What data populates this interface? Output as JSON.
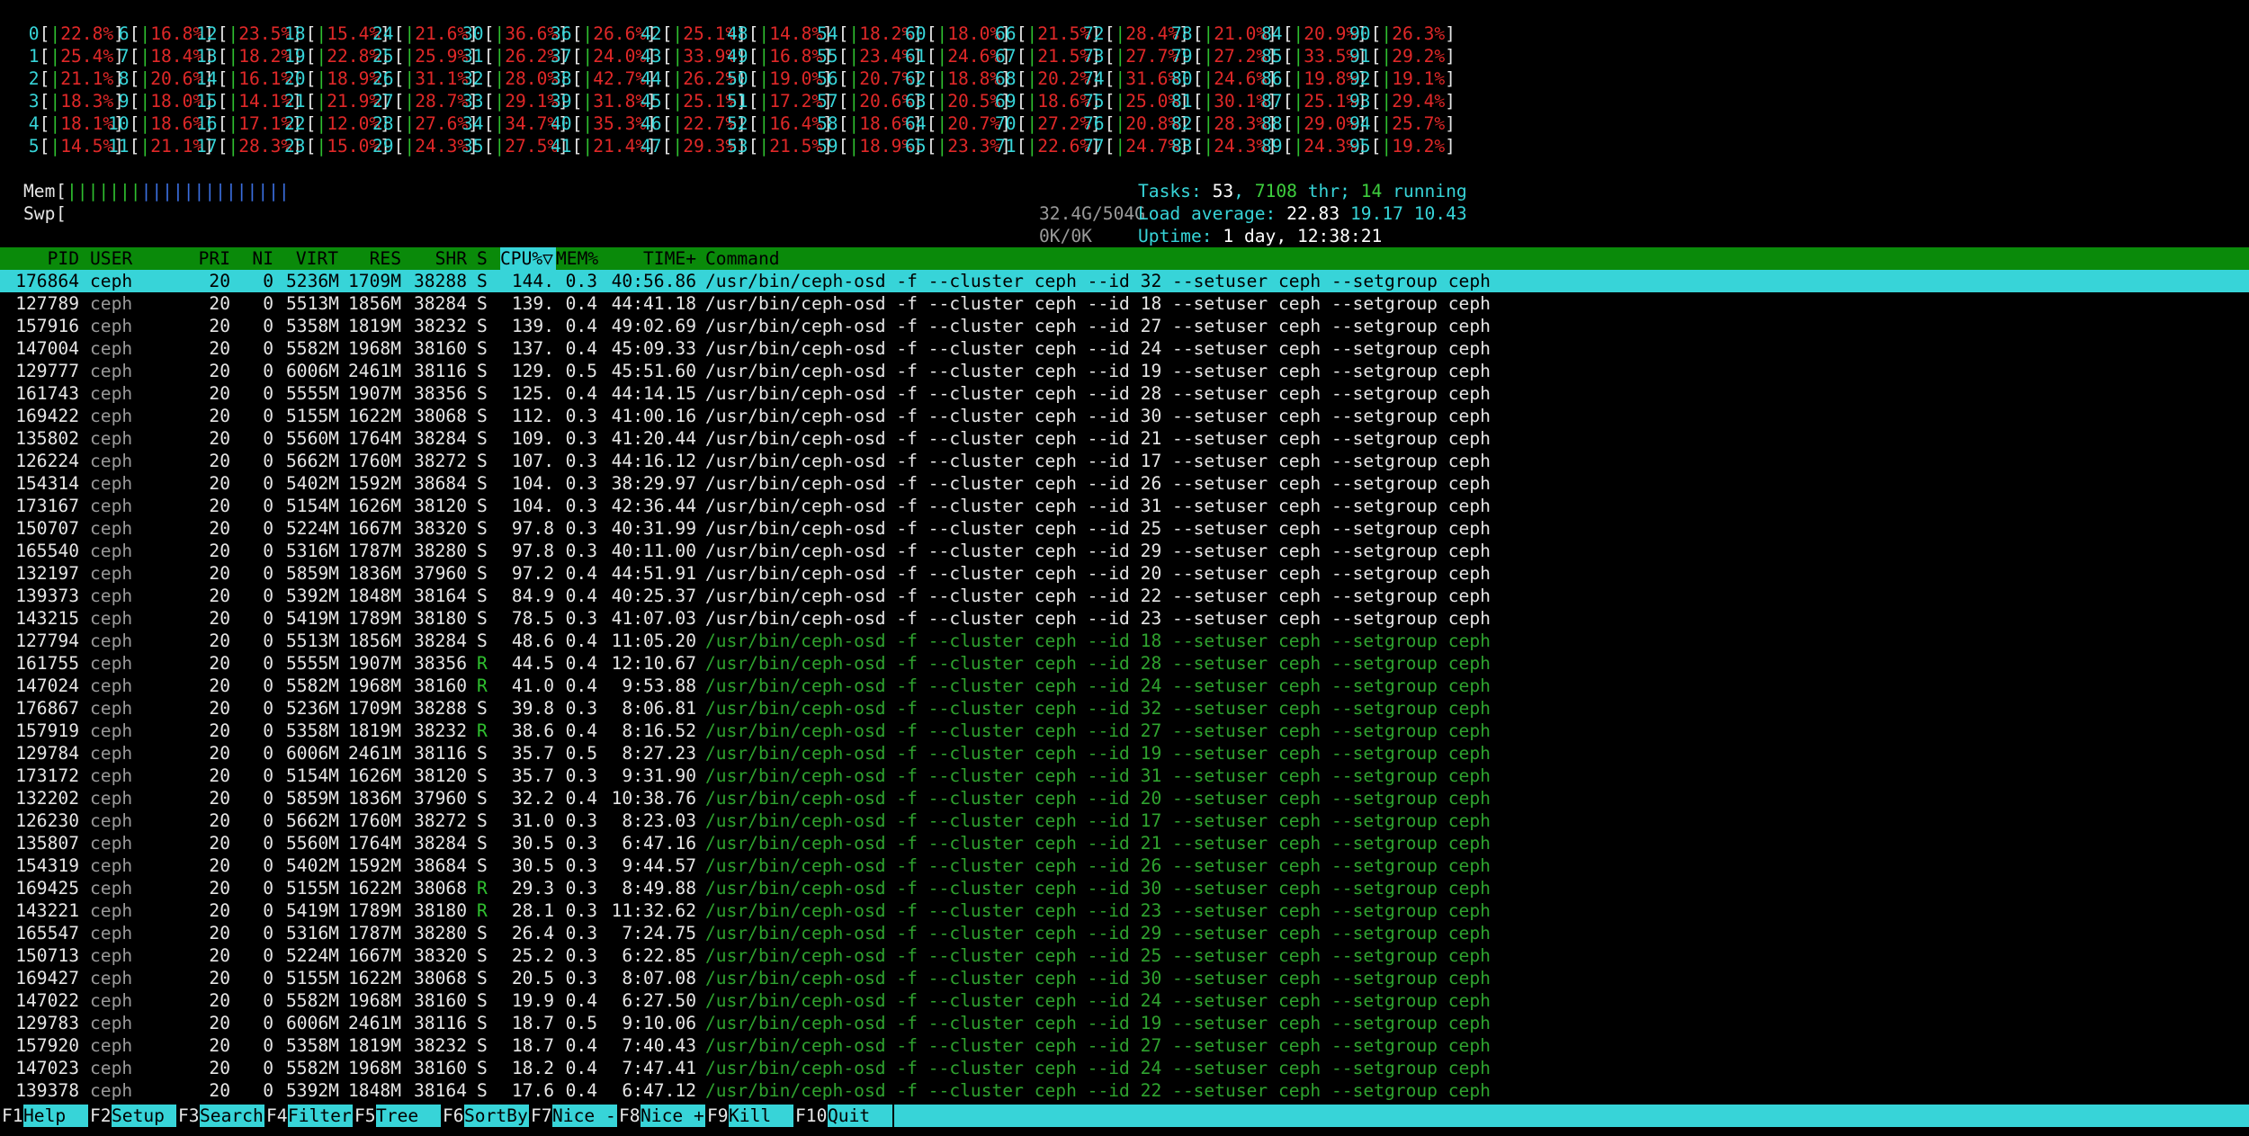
{
  "cpus": [
    {
      "id": "0",
      "pct": "22.8%"
    },
    {
      "id": "1",
      "pct": "25.4%"
    },
    {
      "id": "2",
      "pct": "21.1%"
    },
    {
      "id": "3",
      "pct": "18.3%"
    },
    {
      "id": "4",
      "pct": "18.1%"
    },
    {
      "id": "5",
      "pct": "14.5%"
    },
    {
      "id": "6",
      "pct": "16.8%"
    },
    {
      "id": "7",
      "pct": "18.4%"
    },
    {
      "id": "8",
      "pct": "20.6%"
    },
    {
      "id": "9",
      "pct": "18.0%"
    },
    {
      "id": "10",
      "pct": "18.6%"
    },
    {
      "id": "11",
      "pct": "21.1%"
    },
    {
      "id": "12",
      "pct": "23.5%"
    },
    {
      "id": "13",
      "pct": "18.2%"
    },
    {
      "id": "14",
      "pct": "16.1%"
    },
    {
      "id": "15",
      "pct": "14.1%"
    },
    {
      "id": "16",
      "pct": "17.1%"
    },
    {
      "id": "17",
      "pct": "28.3%"
    },
    {
      "id": "18",
      "pct": "15.4%"
    },
    {
      "id": "19",
      "pct": "22.8%"
    },
    {
      "id": "20",
      "pct": "18.9%"
    },
    {
      "id": "21",
      "pct": "21.9%"
    },
    {
      "id": "22",
      "pct": "12.0%"
    },
    {
      "id": "23",
      "pct": "15.0%"
    },
    {
      "id": "24",
      "pct": "21.6%"
    },
    {
      "id": "25",
      "pct": "25.9%"
    },
    {
      "id": "26",
      "pct": "31.1%"
    },
    {
      "id": "27",
      "pct": "28.7%"
    },
    {
      "id": "28",
      "pct": "27.6%"
    },
    {
      "id": "29",
      "pct": "24.3%"
    },
    {
      "id": "30",
      "pct": "36.6%"
    },
    {
      "id": "31",
      "pct": "26.2%"
    },
    {
      "id": "32",
      "pct": "28.0%"
    },
    {
      "id": "33",
      "pct": "29.1%"
    },
    {
      "id": "34",
      "pct": "34.7%"
    },
    {
      "id": "35",
      "pct": "27.5%"
    },
    {
      "id": "36",
      "pct": "26.6%"
    },
    {
      "id": "37",
      "pct": "24.0%"
    },
    {
      "id": "38",
      "pct": "42.7%"
    },
    {
      "id": "39",
      "pct": "31.8%"
    },
    {
      "id": "40",
      "pct": "35.3%"
    },
    {
      "id": "41",
      "pct": "21.4%"
    },
    {
      "id": "42",
      "pct": "25.1%"
    },
    {
      "id": "43",
      "pct": "33.9%"
    },
    {
      "id": "44",
      "pct": "26.2%"
    },
    {
      "id": "45",
      "pct": "25.1%"
    },
    {
      "id": "46",
      "pct": "22.7%"
    },
    {
      "id": "47",
      "pct": "29.3%"
    },
    {
      "id": "48",
      "pct": "14.8%"
    },
    {
      "id": "49",
      "pct": "16.8%"
    },
    {
      "id": "50",
      "pct": "19.0%"
    },
    {
      "id": "51",
      "pct": "17.2%"
    },
    {
      "id": "52",
      "pct": "16.4%"
    },
    {
      "id": "53",
      "pct": "21.5%"
    },
    {
      "id": "54",
      "pct": "18.2%"
    },
    {
      "id": "55",
      "pct": "23.4%"
    },
    {
      "id": "56",
      "pct": "20.7%"
    },
    {
      "id": "57",
      "pct": "20.6%"
    },
    {
      "id": "58",
      "pct": "18.6%"
    },
    {
      "id": "59",
      "pct": "18.9%"
    },
    {
      "id": "60",
      "pct": "18.0%"
    },
    {
      "id": "61",
      "pct": "24.6%"
    },
    {
      "id": "62",
      "pct": "18.8%"
    },
    {
      "id": "63",
      "pct": "20.5%"
    },
    {
      "id": "64",
      "pct": "20.7%"
    },
    {
      "id": "65",
      "pct": "23.3%"
    },
    {
      "id": "66",
      "pct": "21.5%"
    },
    {
      "id": "67",
      "pct": "21.5%"
    },
    {
      "id": "68",
      "pct": "20.2%"
    },
    {
      "id": "69",
      "pct": "18.6%"
    },
    {
      "id": "70",
      "pct": "27.2%"
    },
    {
      "id": "71",
      "pct": "22.6%"
    },
    {
      "id": "72",
      "pct": "28.4%"
    },
    {
      "id": "73",
      "pct": "27.7%"
    },
    {
      "id": "74",
      "pct": "31.6%"
    },
    {
      "id": "75",
      "pct": "25.0%"
    },
    {
      "id": "76",
      "pct": "20.8%"
    },
    {
      "id": "77",
      "pct": "24.7%"
    },
    {
      "id": "78",
      "pct": "21.0%"
    },
    {
      "id": "79",
      "pct": "27.2%"
    },
    {
      "id": "80",
      "pct": "24.6%"
    },
    {
      "id": "81",
      "pct": "30.1%"
    },
    {
      "id": "82",
      "pct": "28.3%"
    },
    {
      "id": "83",
      "pct": "24.3%"
    },
    {
      "id": "84",
      "pct": "20.9%"
    },
    {
      "id": "85",
      "pct": "33.5%"
    },
    {
      "id": "86",
      "pct": "19.8%"
    },
    {
      "id": "87",
      "pct": "25.1%"
    },
    {
      "id": "88",
      "pct": "29.0%"
    },
    {
      "id": "89",
      "pct": "24.3%"
    },
    {
      "id": "90",
      "pct": "26.3%"
    },
    {
      "id": "91",
      "pct": "29.2%"
    },
    {
      "id": "92",
      "pct": "19.1%"
    },
    {
      "id": "93",
      "pct": "29.4%"
    },
    {
      "id": "94",
      "pct": "25.7%"
    },
    {
      "id": "95",
      "pct": "19.2%"
    }
  ],
  "mem": {
    "label": "Mem",
    "bar": "||||||||||||||",
    "value": "32.4G/504G"
  },
  "swp": {
    "label": "Swp",
    "value": "0K/0K"
  },
  "tasks": {
    "label": "Tasks:",
    "count": "53",
    "sep1": ",",
    "thr": "7108",
    "thr_label": "thr;",
    "running": "14",
    "running_label": "running"
  },
  "load": {
    "label": "Load average:",
    "l1": "22.83",
    "l5": "19.17",
    "l15": "10.43"
  },
  "uptime": {
    "label": "Uptime:",
    "value": "1 day, 12:38:21"
  },
  "header": {
    "pid": "PID",
    "user": "USER",
    "pri": "PRI",
    "ni": "NI",
    "virt": "VIRT",
    "res": "RES",
    "shr": "SHR",
    "s": "S",
    "cpu": "CPU%▽",
    "mem": "MEM%",
    "time": "TIME+",
    "command": "Command"
  },
  "processes": [
    {
      "pid": "176864",
      "user": "ceph",
      "pri": "20",
      "ni": "0",
      "virt": "5236M",
      "res": "1709M",
      "shr": "38288",
      "s": "S",
      "cpu": "144.",
      "mem": "0.3",
      "time": "40:56.86",
      "command": "/usr/bin/ceph-osd -f --cluster ceph --id 32 --setuser ceph --setgroup ceph",
      "sel": true
    },
    {
      "pid": "127789",
      "user": "ceph",
      "pri": "20",
      "ni": "0",
      "virt": "5513M",
      "res": "1856M",
      "shr": "38284",
      "s": "S",
      "cpu": "139.",
      "mem": "0.4",
      "time": "44:41.18",
      "command": "/usr/bin/ceph-osd -f --cluster ceph --id 18 --setuser ceph --setgroup ceph"
    },
    {
      "pid": "157916",
      "user": "ceph",
      "pri": "20",
      "ni": "0",
      "virt": "5358M",
      "res": "1819M",
      "shr": "38232",
      "s": "S",
      "cpu": "139.",
      "mem": "0.4",
      "time": "49:02.69",
      "command": "/usr/bin/ceph-osd -f --cluster ceph --id 27 --setuser ceph --setgroup ceph"
    },
    {
      "pid": "147004",
      "user": "ceph",
      "pri": "20",
      "ni": "0",
      "virt": "5582M",
      "res": "1968M",
      "shr": "38160",
      "s": "S",
      "cpu": "137.",
      "mem": "0.4",
      "time": "45:09.33",
      "command": "/usr/bin/ceph-osd -f --cluster ceph --id 24 --setuser ceph --setgroup ceph"
    },
    {
      "pid": "129777",
      "user": "ceph",
      "pri": "20",
      "ni": "0",
      "virt": "6006M",
      "res": "2461M",
      "shr": "38116",
      "s": "S",
      "cpu": "129.",
      "mem": "0.5",
      "time": "45:51.60",
      "command": "/usr/bin/ceph-osd -f --cluster ceph --id 19 --setuser ceph --setgroup ceph"
    },
    {
      "pid": "161743",
      "user": "ceph",
      "pri": "20",
      "ni": "0",
      "virt": "5555M",
      "res": "1907M",
      "shr": "38356",
      "s": "S",
      "cpu": "125.",
      "mem": "0.4",
      "time": "44:14.15",
      "command": "/usr/bin/ceph-osd -f --cluster ceph --id 28 --setuser ceph --setgroup ceph"
    },
    {
      "pid": "169422",
      "user": "ceph",
      "pri": "20",
      "ni": "0",
      "virt": "5155M",
      "res": "1622M",
      "shr": "38068",
      "s": "S",
      "cpu": "112.",
      "mem": "0.3",
      "time": "41:00.16",
      "command": "/usr/bin/ceph-osd -f --cluster ceph --id 30 --setuser ceph --setgroup ceph"
    },
    {
      "pid": "135802",
      "user": "ceph",
      "pri": "20",
      "ni": "0",
      "virt": "5560M",
      "res": "1764M",
      "shr": "38284",
      "s": "S",
      "cpu": "109.",
      "mem": "0.3",
      "time": "41:20.44",
      "command": "/usr/bin/ceph-osd -f --cluster ceph --id 21 --setuser ceph --setgroup ceph"
    },
    {
      "pid": "126224",
      "user": "ceph",
      "pri": "20",
      "ni": "0",
      "virt": "5662M",
      "res": "1760M",
      "shr": "38272",
      "s": "S",
      "cpu": "107.",
      "mem": "0.3",
      "time": "44:16.12",
      "command": "/usr/bin/ceph-osd -f --cluster ceph --id 17 --setuser ceph --setgroup ceph"
    },
    {
      "pid": "154314",
      "user": "ceph",
      "pri": "20",
      "ni": "0",
      "virt": "5402M",
      "res": "1592M",
      "shr": "38684",
      "s": "S",
      "cpu": "104.",
      "mem": "0.3",
      "time": "38:29.97",
      "command": "/usr/bin/ceph-osd -f --cluster ceph --id 26 --setuser ceph --setgroup ceph"
    },
    {
      "pid": "173167",
      "user": "ceph",
      "pri": "20",
      "ni": "0",
      "virt": "5154M",
      "res": "1626M",
      "shr": "38120",
      "s": "S",
      "cpu": "104.",
      "mem": "0.3",
      "time": "42:36.44",
      "command": "/usr/bin/ceph-osd -f --cluster ceph --id 31 --setuser ceph --setgroup ceph"
    },
    {
      "pid": "150707",
      "user": "ceph",
      "pri": "20",
      "ni": "0",
      "virt": "5224M",
      "res": "1667M",
      "shr": "38320",
      "s": "S",
      "cpu": "97.8",
      "mem": "0.3",
      "time": "40:31.99",
      "command": "/usr/bin/ceph-osd -f --cluster ceph --id 25 --setuser ceph --setgroup ceph"
    },
    {
      "pid": "165540",
      "user": "ceph",
      "pri": "20",
      "ni": "0",
      "virt": "5316M",
      "res": "1787M",
      "shr": "38280",
      "s": "S",
      "cpu": "97.8",
      "mem": "0.3",
      "time": "40:11.00",
      "command": "/usr/bin/ceph-osd -f --cluster ceph --id 29 --setuser ceph --setgroup ceph"
    },
    {
      "pid": "132197",
      "user": "ceph",
      "pri": "20",
      "ni": "0",
      "virt": "5859M",
      "res": "1836M",
      "shr": "37960",
      "s": "S",
      "cpu": "97.2",
      "mem": "0.4",
      "time": "44:51.91",
      "command": "/usr/bin/ceph-osd -f --cluster ceph --id 20 --setuser ceph --setgroup ceph"
    },
    {
      "pid": "139373",
      "user": "ceph",
      "pri": "20",
      "ni": "0",
      "virt": "5392M",
      "res": "1848M",
      "shr": "38164",
      "s": "S",
      "cpu": "84.9",
      "mem": "0.4",
      "time": "40:25.37",
      "command": "/usr/bin/ceph-osd -f --cluster ceph --id 22 --setuser ceph --setgroup ceph"
    },
    {
      "pid": "143215",
      "user": "ceph",
      "pri": "20",
      "ni": "0",
      "virt": "5419M",
      "res": "1789M",
      "shr": "38180",
      "s": "S",
      "cpu": "78.5",
      "mem": "0.3",
      "time": "41:07.03",
      "command": "/usr/bin/ceph-osd -f --cluster ceph --id 23 --setuser ceph --setgroup ceph"
    },
    {
      "pid": "127794",
      "user": "ceph",
      "pri": "20",
      "ni": "0",
      "virt": "5513M",
      "res": "1856M",
      "shr": "38284",
      "s": "S",
      "cpu": "48.6",
      "mem": "0.4",
      "time": "11:05.20",
      "command": "/usr/bin/ceph-osd -f --cluster ceph --id 18 --setuser ceph --setgroup ceph",
      "thr": true
    },
    {
      "pid": "161755",
      "user": "ceph",
      "pri": "20",
      "ni": "0",
      "virt": "5555M",
      "res": "1907M",
      "shr": "38356",
      "s": "R",
      "cpu": "44.5",
      "mem": "0.4",
      "time": "12:10.67",
      "command": "/usr/bin/ceph-osd -f --cluster ceph --id 28 --setuser ceph --setgroup ceph",
      "thr": true
    },
    {
      "pid": "147024",
      "user": "ceph",
      "pri": "20",
      "ni": "0",
      "virt": "5582M",
      "res": "1968M",
      "shr": "38160",
      "s": "R",
      "cpu": "41.0",
      "mem": "0.4",
      "time": "9:53.88",
      "command": "/usr/bin/ceph-osd -f --cluster ceph --id 24 --setuser ceph --setgroup ceph",
      "thr": true
    },
    {
      "pid": "176867",
      "user": "ceph",
      "pri": "20",
      "ni": "0",
      "virt": "5236M",
      "res": "1709M",
      "shr": "38288",
      "s": "S",
      "cpu": "39.8",
      "mem": "0.3",
      "time": "8:06.81",
      "command": "/usr/bin/ceph-osd -f --cluster ceph --id 32 --setuser ceph --setgroup ceph",
      "thr": true
    },
    {
      "pid": "157919",
      "user": "ceph",
      "pri": "20",
      "ni": "0",
      "virt": "5358M",
      "res": "1819M",
      "shr": "38232",
      "s": "R",
      "cpu": "38.6",
      "mem": "0.4",
      "time": "8:16.52",
      "command": "/usr/bin/ceph-osd -f --cluster ceph --id 27 --setuser ceph --setgroup ceph",
      "thr": true
    },
    {
      "pid": "129784",
      "user": "ceph",
      "pri": "20",
      "ni": "0",
      "virt": "6006M",
      "res": "2461M",
      "shr": "38116",
      "s": "S",
      "cpu": "35.7",
      "mem": "0.5",
      "time": "8:27.23",
      "command": "/usr/bin/ceph-osd -f --cluster ceph --id 19 --setuser ceph --setgroup ceph",
      "thr": true
    },
    {
      "pid": "173172",
      "user": "ceph",
      "pri": "20",
      "ni": "0",
      "virt": "5154M",
      "res": "1626M",
      "shr": "38120",
      "s": "S",
      "cpu": "35.7",
      "mem": "0.3",
      "time": "9:31.90",
      "command": "/usr/bin/ceph-osd -f --cluster ceph --id 31 --setuser ceph --setgroup ceph",
      "thr": true
    },
    {
      "pid": "132202",
      "user": "ceph",
      "pri": "20",
      "ni": "0",
      "virt": "5859M",
      "res": "1836M",
      "shr": "37960",
      "s": "S",
      "cpu": "32.2",
      "mem": "0.4",
      "time": "10:38.76",
      "command": "/usr/bin/ceph-osd -f --cluster ceph --id 20 --setuser ceph --setgroup ceph",
      "thr": true
    },
    {
      "pid": "126230",
      "user": "ceph",
      "pri": "20",
      "ni": "0",
      "virt": "5662M",
      "res": "1760M",
      "shr": "38272",
      "s": "S",
      "cpu": "31.0",
      "mem": "0.3",
      "time": "8:23.03",
      "command": "/usr/bin/ceph-osd -f --cluster ceph --id 17 --setuser ceph --setgroup ceph",
      "thr": true
    },
    {
      "pid": "135807",
      "user": "ceph",
      "pri": "20",
      "ni": "0",
      "virt": "5560M",
      "res": "1764M",
      "shr": "38284",
      "s": "S",
      "cpu": "30.5",
      "mem": "0.3",
      "time": "6:47.16",
      "command": "/usr/bin/ceph-osd -f --cluster ceph --id 21 --setuser ceph --setgroup ceph",
      "thr": true
    },
    {
      "pid": "154319",
      "user": "ceph",
      "pri": "20",
      "ni": "0",
      "virt": "5402M",
      "res": "1592M",
      "shr": "38684",
      "s": "S",
      "cpu": "30.5",
      "mem": "0.3",
      "time": "9:44.57",
      "command": "/usr/bin/ceph-osd -f --cluster ceph --id 26 --setuser ceph --setgroup ceph",
      "thr": true
    },
    {
      "pid": "169425",
      "user": "ceph",
      "pri": "20",
      "ni": "0",
      "virt": "5155M",
      "res": "1622M",
      "shr": "38068",
      "s": "R",
      "cpu": "29.3",
      "mem": "0.3",
      "time": "8:49.88",
      "command": "/usr/bin/ceph-osd -f --cluster ceph --id 30 --setuser ceph --setgroup ceph",
      "thr": true
    },
    {
      "pid": "143221",
      "user": "ceph",
      "pri": "20",
      "ni": "0",
      "virt": "5419M",
      "res": "1789M",
      "shr": "38180",
      "s": "R",
      "cpu": "28.1",
      "mem": "0.3",
      "time": "11:32.62",
      "command": "/usr/bin/ceph-osd -f --cluster ceph --id 23 --setuser ceph --setgroup ceph",
      "thr": true
    },
    {
      "pid": "165547",
      "user": "ceph",
      "pri": "20",
      "ni": "0",
      "virt": "5316M",
      "res": "1787M",
      "shr": "38280",
      "s": "S",
      "cpu": "26.4",
      "mem": "0.3",
      "time": "7:24.75",
      "command": "/usr/bin/ceph-osd -f --cluster ceph --id 29 --setuser ceph --setgroup ceph",
      "thr": true
    },
    {
      "pid": "150713",
      "user": "ceph",
      "pri": "20",
      "ni": "0",
      "virt": "5224M",
      "res": "1667M",
      "shr": "38320",
      "s": "S",
      "cpu": "25.2",
      "mem": "0.3",
      "time": "6:22.85",
      "command": "/usr/bin/ceph-osd -f --cluster ceph --id 25 --setuser ceph --setgroup ceph",
      "thr": true
    },
    {
      "pid": "169427",
      "user": "ceph",
      "pri": "20",
      "ni": "0",
      "virt": "5155M",
      "res": "1622M",
      "shr": "38068",
      "s": "S",
      "cpu": "20.5",
      "mem": "0.3",
      "time": "8:07.08",
      "command": "/usr/bin/ceph-osd -f --cluster ceph --id 30 --setuser ceph --setgroup ceph",
      "thr": true
    },
    {
      "pid": "147022",
      "user": "ceph",
      "pri": "20",
      "ni": "0",
      "virt": "5582M",
      "res": "1968M",
      "shr": "38160",
      "s": "S",
      "cpu": "19.9",
      "mem": "0.4",
      "time": "6:27.50",
      "command": "/usr/bin/ceph-osd -f --cluster ceph --id 24 --setuser ceph --setgroup ceph",
      "thr": true
    },
    {
      "pid": "129783",
      "user": "ceph",
      "pri": "20",
      "ni": "0",
      "virt": "6006M",
      "res": "2461M",
      "shr": "38116",
      "s": "S",
      "cpu": "18.7",
      "mem": "0.5",
      "time": "9:10.06",
      "command": "/usr/bin/ceph-osd -f --cluster ceph --id 19 --setuser ceph --setgroup ceph",
      "thr": true
    },
    {
      "pid": "157920",
      "user": "ceph",
      "pri": "20",
      "ni": "0",
      "virt": "5358M",
      "res": "1819M",
      "shr": "38232",
      "s": "S",
      "cpu": "18.7",
      "mem": "0.4",
      "time": "7:40.43",
      "command": "/usr/bin/ceph-osd -f --cluster ceph --id 27 --setuser ceph --setgroup ceph",
      "thr": true
    },
    {
      "pid": "147023",
      "user": "ceph",
      "pri": "20",
      "ni": "0",
      "virt": "5582M",
      "res": "1968M",
      "shr": "38160",
      "s": "S",
      "cpu": "18.2",
      "mem": "0.4",
      "time": "7:47.41",
      "command": "/usr/bin/ceph-osd -f --cluster ceph --id 24 --setuser ceph --setgroup ceph",
      "thr": true
    },
    {
      "pid": "139378",
      "user": "ceph",
      "pri": "20",
      "ni": "0",
      "virt": "5392M",
      "res": "1848M",
      "shr": "38164",
      "s": "S",
      "cpu": "17.6",
      "mem": "0.4",
      "time": "6:47.12",
      "command": "/usr/bin/ceph-osd -f --cluster ceph --id 22 --setuser ceph --setgroup ceph",
      "thr": true
    }
  ],
  "footer": [
    {
      "key": "F1",
      "label": "Help  "
    },
    {
      "key": "F2",
      "label": "Setup "
    },
    {
      "key": "F3",
      "label": "Search"
    },
    {
      "key": "F4",
      "label": "Filter"
    },
    {
      "key": "F5",
      "label": "Tree  "
    },
    {
      "key": "F6",
      "label": "SortBy"
    },
    {
      "key": "F7",
      "label": "Nice -"
    },
    {
      "key": "F8",
      "label": "Nice +"
    },
    {
      "key": "F9",
      "label": "Kill  "
    },
    {
      "key": "F10",
      "label": "Quit  "
    }
  ]
}
